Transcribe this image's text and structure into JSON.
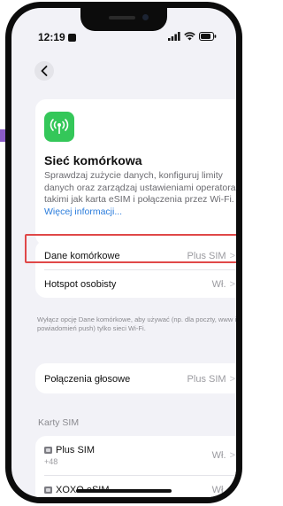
{
  "status_bar": {
    "time": "12:19"
  },
  "hero": {
    "title": "Sieć komórkowa",
    "description": "Sprawdzaj zużycie danych, konfiguruj limity danych oraz zarządzaj ustawieniami operatora, takimi jak karta eSIM i połączenia przez Wi-Fi.",
    "link": "Więcej informacji..."
  },
  "group1": {
    "mobile_data": {
      "label": "Dane komórkowe",
      "value": "Plus SIM"
    },
    "hotspot": {
      "label": "Hotspot osobisty",
      "value": "Wł."
    }
  },
  "footnote": "Wyłącz opcję Dane komórkowe, aby używać (np. dla poczty, www i powiadomień push) tylko sieci Wi-Fi.",
  "group2": {
    "voice": {
      "label": "Połączenia głosowe",
      "value": "Plus SIM"
    }
  },
  "sim_section": {
    "header": "Karty SIM",
    "cards": [
      {
        "name": "Plus SIM",
        "number": "+48",
        "value": "Wł."
      },
      {
        "name": "XOXO eSIM",
        "value": "Wł."
      }
    ]
  },
  "colors": {
    "accent_blue": "#2a7cdc",
    "icon_green": "#34c759",
    "highlight_red": "#e04848",
    "purple_accent": "#8b5cc7"
  },
  "icons": [
    "back-chevron-icon",
    "antenna-icon",
    "chevron-right-icon",
    "sim-card-icon",
    "wifi-icon",
    "battery-icon",
    "signal-icon"
  ]
}
